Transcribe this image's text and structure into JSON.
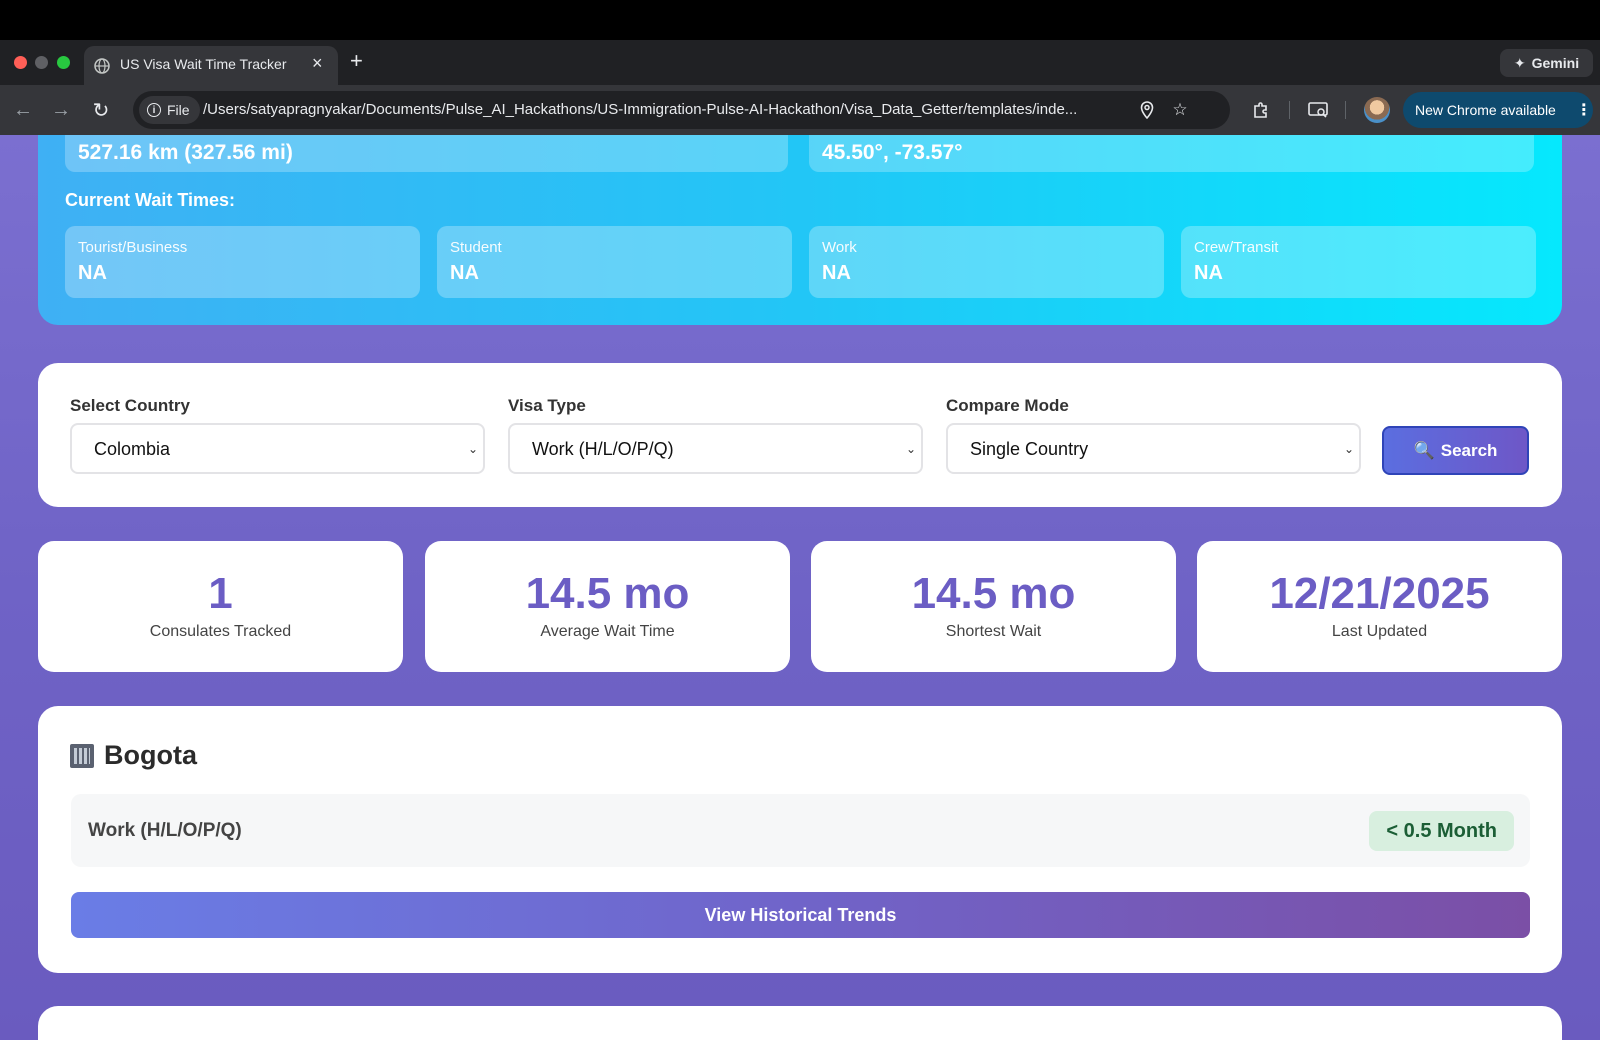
{
  "browser": {
    "tab_title": "US Visa Wait Time Tracker",
    "gemini_label": "Gemini",
    "file_chip": "File",
    "url": "/Users/satyapragnyakar/Documents/Pulse_AI_Hackathons/US-Immigration-Pulse-AI-Hackathon/Visa_Data_Getter/templates/inde...",
    "update_label": "New Chrome available"
  },
  "hero": {
    "distance": "527.16 km (327.56 mi)",
    "coordinates": "45.50°, -73.57°",
    "wait_heading": "Current Wait Times:",
    "wait_times": [
      {
        "label": "Tourist/Business",
        "value": "NA"
      },
      {
        "label": "Student",
        "value": "NA"
      },
      {
        "label": "Work",
        "value": "NA"
      },
      {
        "label": "Crew/Transit",
        "value": "NA"
      }
    ]
  },
  "filters": {
    "country_label": "Select Country",
    "country_value": "Colombia",
    "visa_label": "Visa Type",
    "visa_value": "Work (H/L/O/P/Q)",
    "compare_label": "Compare Mode",
    "compare_value": "Single Country",
    "search_label": "Search"
  },
  "stats": [
    {
      "value": "1",
      "caption": "Consulates Tracked"
    },
    {
      "value": "14.5 mo",
      "caption": "Average Wait Time"
    },
    {
      "value": "14.5 mo",
      "caption": "Shortest Wait"
    },
    {
      "value": "12/21/2025",
      "caption": "Last Updated"
    }
  ],
  "consulate": {
    "city": "Bogota",
    "visa_type": "Work (H/L/O/P/Q)",
    "wait": "< 0.5 Month",
    "trends_label": "View Historical Trends"
  }
}
